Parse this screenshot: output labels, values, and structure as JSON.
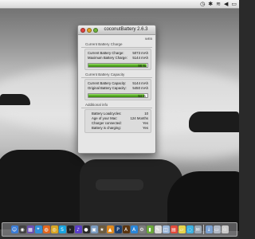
{
  "menubar": {
    "icons": [
      "time-machine-icon",
      "bluetooth-icon",
      "wifi-icon",
      "volume-icon",
      "battery-icon"
    ],
    "glyphs": [
      "◷",
      "✱",
      "≋",
      "◀",
      "▭"
    ]
  },
  "window": {
    "title": "coconutBattery 2.6.3",
    "toolbar_label": "WEB",
    "sections": {
      "current_charge": {
        "label": "Current Battery Charge",
        "rows": [
          {
            "label": "Current Battery Charge:",
            "value": "5073 mAh"
          },
          {
            "label": "Maximum Battery Charge:",
            "value": "5144 mAh"
          }
        ],
        "percent_label": "98 %",
        "percent_value": 98
      },
      "current_capacity": {
        "label": "Current Battery Capacity",
        "rows": [
          {
            "label": "Current Battery Capacity:",
            "value": "5144 mAh"
          },
          {
            "label": "Original Battery Capacity:",
            "value": "5450 mAh"
          }
        ],
        "percent_label": "94 %",
        "percent_value": 94
      },
      "additional": {
        "label": "Additional info",
        "rows": [
          {
            "label": "Battery Loadcycles:",
            "value": "10"
          },
          {
            "label": "Age of your Mac:",
            "value": "124 Months"
          },
          {
            "label": "Charger connected:",
            "value": "Yes"
          },
          {
            "label": "Battery is charging:",
            "value": "Yes"
          }
        ]
      }
    }
  },
  "dock": {
    "items": [
      {
        "name": "finder-icon",
        "color": "#3a7bd5",
        "glyph": "☺"
      },
      {
        "name": "dashboard-icon",
        "color": "#444444",
        "glyph": "◉"
      },
      {
        "name": "mission-control-icon",
        "color": "#6a4fb0",
        "glyph": "▦"
      },
      {
        "name": "safari-icon",
        "color": "#2f8fd8",
        "glyph": "⌖"
      },
      {
        "name": "firefox-icon",
        "color": "#e0661e",
        "glyph": "◍"
      },
      {
        "name": "chrome-icon",
        "color": "#d8a623",
        "glyph": "◎"
      },
      {
        "name": "skype-icon",
        "color": "#19a4e0",
        "glyph": "S"
      },
      {
        "name": "terminal-icon",
        "color": "#222222",
        "glyph": "›"
      },
      {
        "name": "itunes-icon",
        "color": "#5a3ec8",
        "glyph": "♪"
      },
      {
        "name": "dvd-player-icon",
        "color": "#2a2a2a",
        "glyph": "●"
      },
      {
        "name": "iphoto-icon",
        "color": "#7a9bc0",
        "glyph": "▣"
      },
      {
        "name": "imovie-icon",
        "color": "#6d5c3f",
        "glyph": "★"
      },
      {
        "name": "vlc-icon",
        "color": "#e08a1e",
        "glyph": "▲"
      },
      {
        "name": "photoshop-icon",
        "color": "#1c3f6e",
        "glyph": "P"
      },
      {
        "name": "illustrator-icon",
        "color": "#5a3510",
        "glyph": "A"
      },
      {
        "name": "app-store-icon",
        "color": "#2a86d8",
        "glyph": "A"
      },
      {
        "name": "system-preferences-icon",
        "color": "#7c7c7c",
        "glyph": "⚙"
      },
      {
        "name": "coconutbattery-icon",
        "color": "#6aa83a",
        "glyph": "▮"
      },
      {
        "name": "textedit-icon",
        "color": "#d9d9d9",
        "glyph": "✎"
      },
      {
        "name": "preview-icon",
        "color": "#9bb6d8",
        "glyph": "◫"
      },
      {
        "name": "calendar-icon",
        "color": "#e24a3a",
        "glyph": "▤"
      },
      {
        "name": "stickies-icon",
        "color": "#e6d34a",
        "glyph": "▱"
      },
      {
        "name": "messages-icon",
        "color": "#3bb0e0",
        "glyph": "◌"
      },
      {
        "name": "mail-icon",
        "color": "#9aa7b4",
        "glyph": "✉"
      },
      {
        "name": "downloads-stack-icon",
        "color": "#7aa0d0",
        "glyph": "↓"
      },
      {
        "name": "documents-stack-icon",
        "color": "#b0b8c4",
        "glyph": "▭"
      },
      {
        "name": "trash-icon",
        "color": "#c9c9c9",
        "glyph": "♲"
      }
    ]
  }
}
